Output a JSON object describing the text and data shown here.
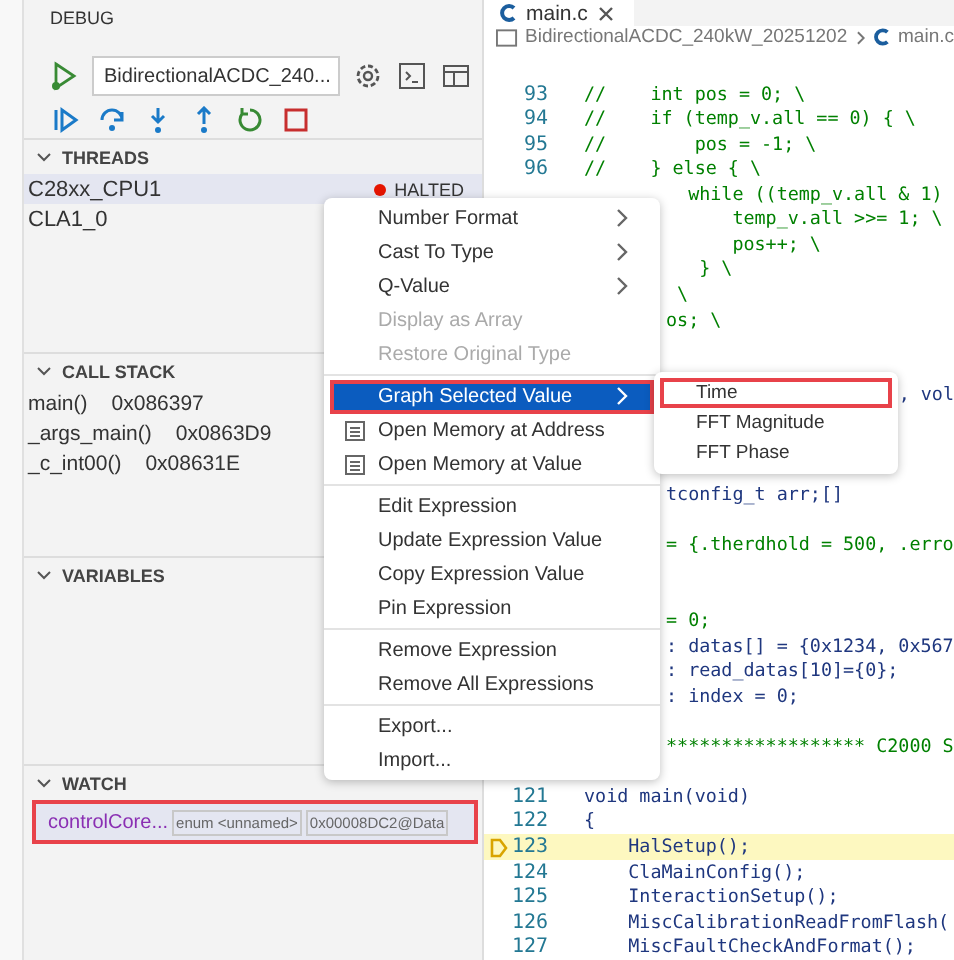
{
  "panel": {
    "title": "DEBUG",
    "config": "BidirectionalACDC_240..."
  },
  "threads": {
    "title": "THREADS",
    "rows": [
      {
        "name": "C28xx_CPU1",
        "status": "HALTED",
        "selected": true
      },
      {
        "name": "CLA1_0",
        "selected": false
      }
    ]
  },
  "call_stack": {
    "title": "CALL STACK",
    "frames": [
      {
        "function": "main()",
        "address": "0x086397"
      },
      {
        "function": "_args_main()",
        "address": "0x0863D9"
      },
      {
        "function": "_c_int00()",
        "address": "0x08631E"
      }
    ]
  },
  "variables": {
    "title": "VARIABLES"
  },
  "watch": {
    "title": "WATCH",
    "items": [
      {
        "expression": "controlCore...",
        "type": "enum <unnamed>",
        "value": "0x00008DC2@Data",
        "outlined": true
      }
    ]
  },
  "editor": {
    "tab": "main.c",
    "breadcrumb": [
      "BidirectionalACDC_240kW_20251202",
      "main.c"
    ],
    "lines": [
      {
        "num": "93",
        "text": "//    int pos = 0; \\",
        "kind": "comment"
      },
      {
        "num": "94",
        "text": "//    if (temp_v.all == 0) { \\",
        "kind": "comment"
      },
      {
        "num": "95",
        "text": "//        pos = -1; \\",
        "kind": "comment"
      },
      {
        "num": "96",
        "text": "//    } else { \\",
        "kind": "comment"
      },
      {
        "text": "  while ((temp_v.all & 1)",
        "kind": "comment"
      },
      {
        "text": "      temp_v.all >>= 1; \\",
        "kind": "comment"
      },
      {
        "text": "      pos++; \\",
        "kind": "comment"
      },
      {
        "text": "   } \\",
        "kind": "comment"
      },
      {
        "text": " \\",
        "kind": "comment"
      },
      {
        "text": "os; \\",
        "kind": "comment"
      },
      {
        "kind": "blank"
      },
      {
        "kind": "blank"
      },
      {
        "text": ", vol",
        "kind": "far"
      },
      {
        "kind": "blank"
      },
      {
        "kind": "blank"
      },
      {
        "kind": "blank"
      },
      {
        "text": "tconfig_t arr;[]",
        "kind": "code"
      },
      {
        "kind": "blank"
      },
      {
        "text": "= {.therdhold = 500, .erro",
        "kind": "comment"
      },
      {
        "kind": "blank"
      },
      {
        "kind": "blank"
      },
      {
        "text": "= 0;",
        "kind": "comment"
      },
      {
        "text": ": datas[] = {0x1234, 0x567",
        "kind": "code"
      },
      {
        "text": ": read_datas[10]={0};",
        "kind": "code"
      },
      {
        "text": ": index = 0;",
        "kind": "code"
      },
      {
        "kind": "blank"
      },
      {
        "text": "****************** C2000 S",
        "kind": "comment"
      },
      {
        "kind": "blank"
      },
      {
        "num": "121",
        "text": "void main(void)",
        "kind": "code"
      },
      {
        "num": "122",
        "text": "{",
        "kind": "code"
      },
      {
        "num": "123",
        "text": "    HalSetup();",
        "kind": "current"
      },
      {
        "num": "124",
        "text": "    ClaMainConfig();",
        "kind": "code"
      },
      {
        "num": "125",
        "text": "    InteractionSetup();",
        "kind": "code"
      },
      {
        "num": "126",
        "text": "    MiscCalibrationReadFromFlash(",
        "kind": "code"
      },
      {
        "num": "127",
        "text": "    MiscFaultCheckAndFormat();",
        "kind": "code"
      }
    ]
  },
  "context_menu": {
    "groups": [
      [
        {
          "label": "Number Format",
          "submenu": true,
          "disabled": false,
          "selected": false,
          "outlined": false,
          "icon": false
        },
        {
          "label": "Cast To Type",
          "submenu": true,
          "disabled": false,
          "selected": false,
          "outlined": false,
          "icon": false
        },
        {
          "label": "Q-Value",
          "submenu": true,
          "disabled": false,
          "selected": false,
          "outlined": false,
          "icon": false
        },
        {
          "label": "Display as Array",
          "submenu": false,
          "disabled": true,
          "selected": false,
          "outlined": false,
          "icon": false
        },
        {
          "label": "Restore Original Type",
          "submenu": false,
          "disabled": true,
          "selected": false,
          "outlined": false,
          "icon": false
        }
      ],
      [
        {
          "label": "Graph Selected Value",
          "submenu": true,
          "disabled": false,
          "selected": true,
          "outlined": true,
          "icon": false
        },
        {
          "label": "Open Memory at Address",
          "submenu": false,
          "disabled": false,
          "selected": false,
          "outlined": false,
          "icon": true
        },
        {
          "label": "Open Memory at Value",
          "submenu": false,
          "disabled": false,
          "selected": false,
          "outlined": false,
          "icon": true
        }
      ],
      [
        {
          "label": "Edit Expression",
          "submenu": false,
          "disabled": false,
          "selected": false,
          "outlined": false,
          "icon": false
        },
        {
          "label": "Update Expression Value",
          "submenu": false,
          "disabled": false,
          "selected": false,
          "outlined": false,
          "icon": false
        },
        {
          "label": "Copy Expression Value",
          "submenu": false,
          "disabled": false,
          "selected": false,
          "outlined": false,
          "icon": false
        },
        {
          "label": "Pin Expression",
          "submenu": false,
          "disabled": false,
          "selected": false,
          "outlined": false,
          "icon": false
        }
      ],
      [
        {
          "label": "Remove Expression",
          "submenu": false,
          "disabled": false,
          "selected": false,
          "outlined": false,
          "icon": false
        },
        {
          "label": "Remove All Expressions",
          "submenu": false,
          "disabled": false,
          "selected": false,
          "outlined": false,
          "icon": false
        }
      ],
      [
        {
          "label": "Export...",
          "submenu": false,
          "disabled": false,
          "selected": false,
          "outlined": false,
          "icon": false
        },
        {
          "label": "Import...",
          "submenu": false,
          "disabled": false,
          "selected": false,
          "outlined": false,
          "icon": false
        }
      ]
    ]
  },
  "submenu": {
    "items": [
      {
        "label": "Time",
        "outlined": true
      },
      {
        "label": "FFT Magnitude",
        "outlined": false
      },
      {
        "label": "FFT Phase",
        "outlined": false
      }
    ]
  }
}
